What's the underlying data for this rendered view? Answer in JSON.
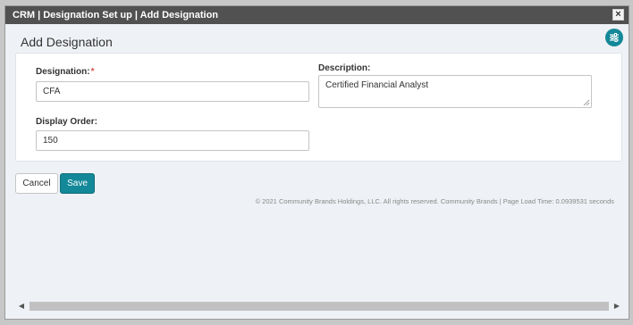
{
  "window": {
    "title": "CRM | Designation Set up | Add Designation",
    "close_icon": "close-icon",
    "close_label": "×"
  },
  "page": {
    "title": "Add Designation",
    "settings_icon": "sliders-icon"
  },
  "form": {
    "designation": {
      "label": "Designation:",
      "required_marker": "*",
      "value": "CFA"
    },
    "description": {
      "label": "Description:",
      "value": "Certified Financial Analyst"
    },
    "display_order": {
      "label": "Display Order:",
      "value": "150"
    }
  },
  "actions": {
    "cancel_label": "Cancel",
    "save_label": "Save"
  },
  "footer": {
    "text": "© 2021 Community Brands Holdings, LLC. All rights reserved. Community Brands | Page Load Time: 0.0939531 seconds"
  },
  "scrollbar": {
    "left_arrow": "◀",
    "right_arrow": "▶"
  },
  "colors": {
    "accent": "#138898",
    "titlebar": "#515151",
    "required": "#d9534f"
  }
}
